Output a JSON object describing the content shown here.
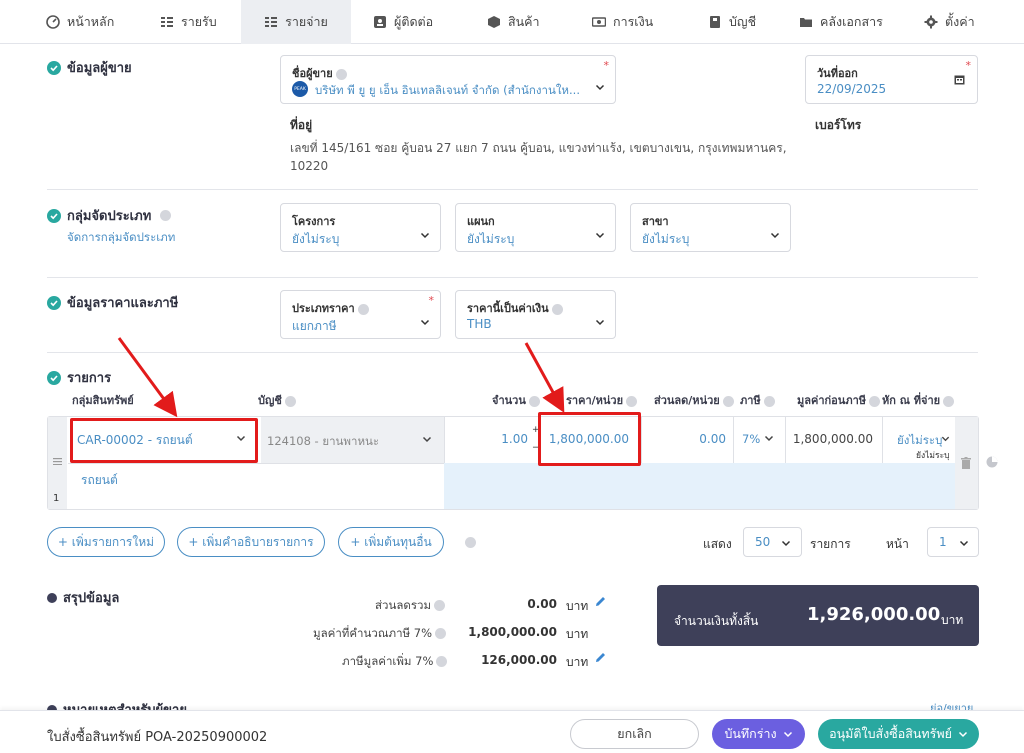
{
  "nav": [
    {
      "label": "หน้าหลัก",
      "icon": "dashboard-icon"
    },
    {
      "label": "รายรับ",
      "icon": "income-list-icon"
    },
    {
      "label": "รายจ่าย",
      "icon": "expense-list-icon"
    },
    {
      "label": "ผู้ติดต่อ",
      "icon": "contacts-icon"
    },
    {
      "label": "สินค้า",
      "icon": "product-box-icon"
    },
    {
      "label": "การเงิน",
      "icon": "money-icon"
    },
    {
      "label": "บัญชี",
      "icon": "accounting-book-icon"
    },
    {
      "label": "คลังเอกสาร",
      "icon": "folder-icon"
    },
    {
      "label": "ตั้งค่า",
      "icon": "gear-icon"
    }
  ],
  "vendor": {
    "section_title": "ข้อมูลผู้ขาย",
    "name_label": "ชื่อผู้ขาย",
    "name_value": "บริษัท พี ยู ยู เอ็น อินเทลลิเจนท์ จำกัด (สำนักงานให...",
    "logo_text": "PEAK",
    "date_label": "วันที่ออก",
    "date_value": "22/09/2025",
    "address_label": "ที่อยู่",
    "address_line1": "เลขที่ 145/161 ซอย คู้บอน 27 แยก 7 ถนน คู้บอน, แขวงท่าแร้ง, เขตบางเขน, กรุงเทพมหานคร,",
    "address_line2": "10220",
    "phone_label": "เบอร์โทร"
  },
  "classification": {
    "section_title": "กลุ่มจัดประเภท",
    "manage_link": "จัดการกลุ่มจัดประเภท",
    "project_label": "โครงการ",
    "project_value": "ยังไม่ระบุ",
    "dept_label": "แผนก",
    "dept_value": "ยังไม่ระบุ",
    "branch_label": "สาขา",
    "branch_value": "ยังไม่ระบุ"
  },
  "pricing": {
    "section_title": "ข้อมูลราคาและภาษี",
    "price_type_label": "ประเภทราคา",
    "price_type_value": "แยกภาษี",
    "currency_label": "ราคานี้เป็นค่าเงิน",
    "currency_value": "THB"
  },
  "items": {
    "section_title": "รายการ",
    "headers": {
      "group": "กลุ่มสินทรัพย์",
      "account": "บัญชี",
      "qty": "จำนวน",
      "price": "ราคา/หน่วย",
      "discount": "ส่วนลด/หน่วย",
      "tax": "ภาษี",
      "pretax": "มูลค่าก่อนภาษี",
      "withholding": "หัก ณ ที่จ่าย"
    },
    "row": {
      "group": "CAR-00002 - รถยนต์",
      "account": "124108 - ยานพาหนะ",
      "qty": "1.00",
      "price": "1,800,000.00",
      "discount": "0.00",
      "tax": "7%",
      "pretax": "1,800,000.00",
      "withholding": "ยังไม่ระบุ",
      "withholding_sub": "ยังไม่ระบุ",
      "description": "รถยนต์",
      "row_no": "1"
    }
  },
  "actions": {
    "add_item": "+ เพิ่มรายการใหม่",
    "add_desc": "+ เพิ่มคำอธิบายรายการ",
    "add_cost": "+ เพิ่มต้นทุนอื่น",
    "show_label": "แสดง",
    "page_size": "50",
    "items_label": "รายการ",
    "page_label": "หน้า",
    "page_value": "1"
  },
  "summary": {
    "section_title": "สรุปข้อมูล",
    "discount_label": "ส่วนลดรวม",
    "discount_value": "0.00",
    "taxable_label": "มูลค่าที่คำนวณภาษี 7%",
    "taxable_value": "1,800,000.00",
    "vat_label": "ภาษีมูลค่าเพิ่ม 7%",
    "vat_value": "126,000.00",
    "currency": "บาท",
    "total_label": "จำนวนเงินทั้งสิ้น",
    "total_value": "1,926,000.00"
  },
  "notes": {
    "section_title": "หมายเหตุสำหรับผู้ขาย",
    "toggle": "ย่อ/ขยาย"
  },
  "footer": {
    "doc_title": "ใบสั่งซื้อสินทรัพย์ POA-20250900002",
    "cancel": "ยกเลิก",
    "save_draft": "บันทึกร่าง",
    "approve": "อนุมัติใบสั่งซื้อสินทรัพย์"
  },
  "colors": {
    "accent": "#4a8ec4",
    "teal": "#29a8a0",
    "purple": "#6b5fe0",
    "dark_panel": "#3e4059",
    "highlight": "#e21b1b"
  }
}
